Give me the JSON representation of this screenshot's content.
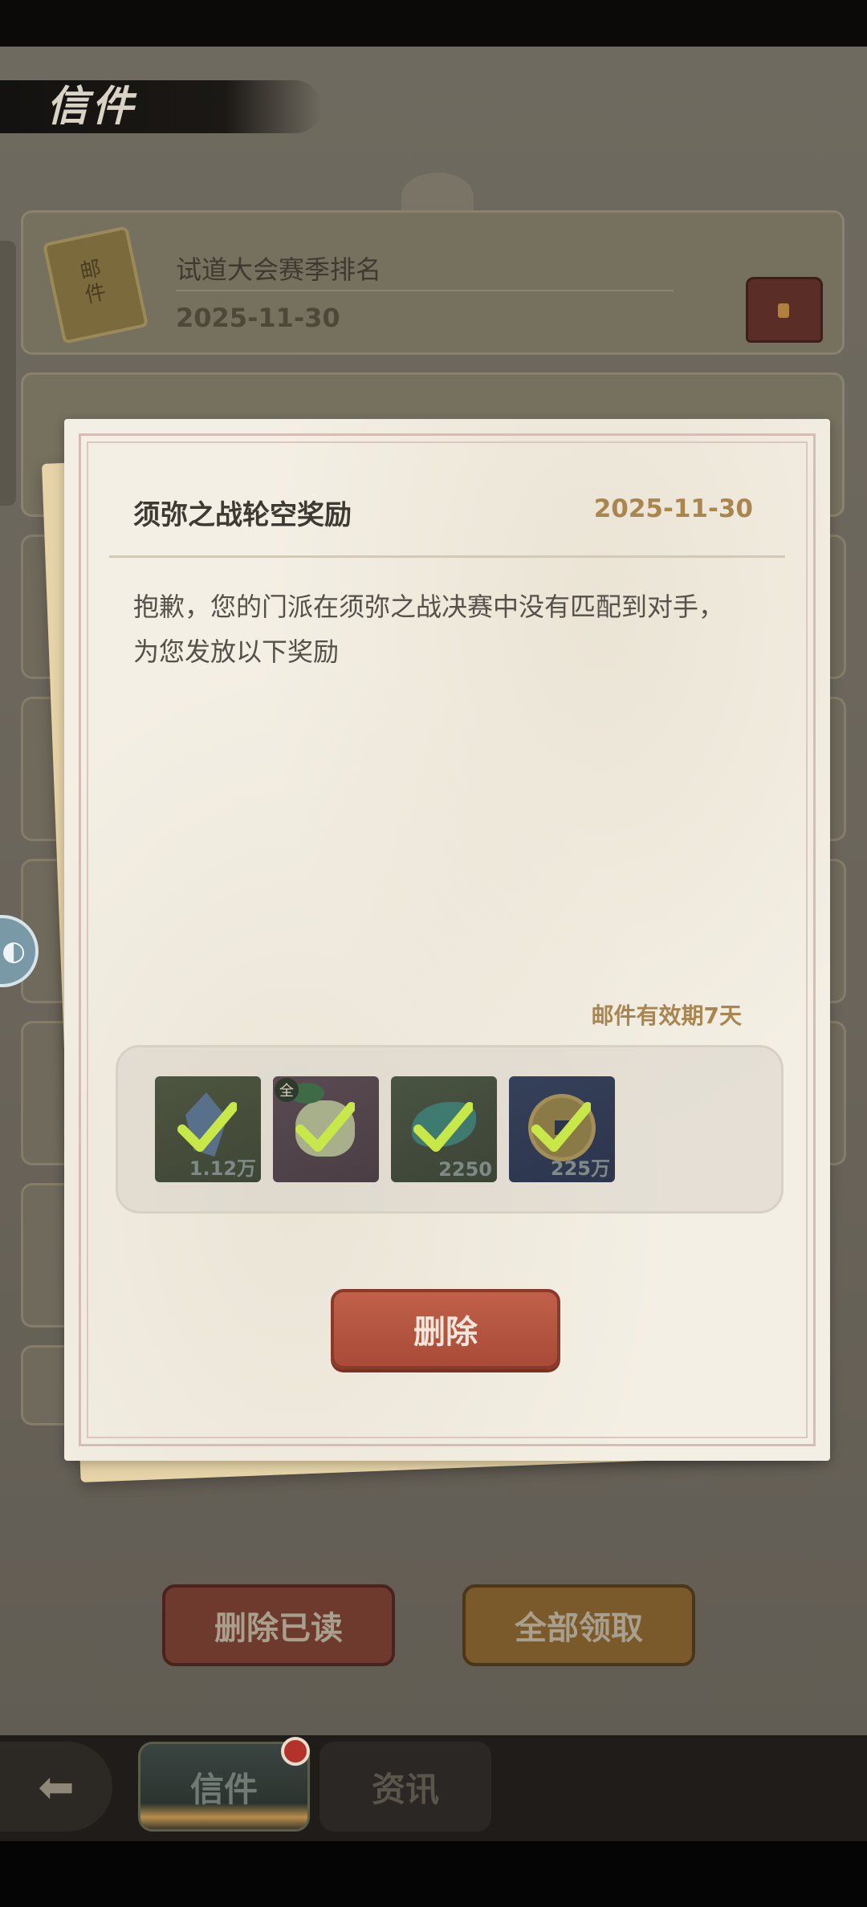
{
  "page": {
    "title": "信件"
  },
  "mail_list": [
    {
      "title": "试道大会赛季排名",
      "date": "2025-11-30"
    }
  ],
  "dialog": {
    "title": "须弥之战轮空奖励",
    "date": "2025-11-30",
    "body_lines": [
      "抱歉，您的门派在须弥之战决赛中没有匹配到对手，",
      "为您发放以下奖励"
    ],
    "validity": "邮件有效期7天",
    "rewards": [
      {
        "icon": "spirit-stone-icon",
        "qty": "1.12万",
        "claimed": true
      },
      {
        "icon": "sprout-pet-icon",
        "badge": "全",
        "qty": "",
        "claimed": true
      },
      {
        "icon": "jade-fish-icon",
        "qty": "2250",
        "claimed": true
      },
      {
        "icon": "copper-coin-icon",
        "qty": "225万",
        "claimed": true
      }
    ],
    "delete_label": "删除"
  },
  "actions": {
    "delete_read_label": "删除已读",
    "claim_all_label": "全部领取"
  },
  "nav": {
    "back_icon": "back-arrow-icon",
    "tabs": [
      {
        "label": "信件",
        "active": true,
        "has_badge": true
      },
      {
        "label": "资讯",
        "active": false,
        "has_badge": false
      }
    ]
  },
  "colors": {
    "accent_gold": "#a98550",
    "delete_red": "#b0503c",
    "badge_red": "#b3322a",
    "check_green": "#c8e84a"
  }
}
